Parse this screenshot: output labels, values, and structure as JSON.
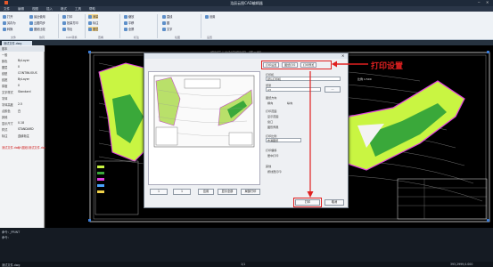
{
  "window": {
    "title": "浩辰云图CAD编辑器"
  },
  "menu": [
    "文件",
    "编辑",
    "视图",
    "插入",
    "格式",
    "工具",
    "帮助"
  ],
  "ribbon": {
    "col1": [
      "打开",
      "另存为",
      "转换"
    ],
    "col2": [
      "最近使用",
      "云图同步",
      "图纸比较"
    ],
    "col3": [
      "打印",
      "批量打印",
      "导出"
    ],
    "col4": [
      "测量",
      "标注",
      "图层"
    ],
    "col5": [
      "缩放",
      "平移",
      "全屏"
    ],
    "col6": [
      "直线",
      "圆",
      "文字"
    ],
    "col7": [
      "设置"
    ],
    "groups": [
      "文件",
      "协同",
      "CAD转换",
      "查看",
      "标注",
      "绘图",
      "设置"
    ]
  },
  "doc_tab": "测试文件.dwg",
  "props": {
    "header": "基本",
    "rows": [
      {
        "k": "一般",
        "v": ""
      },
      {
        "k": "颜色",
        "v": "ByLayer"
      },
      {
        "k": "图层",
        "v": "0"
      },
      {
        "k": "线型",
        "v": "CONTINUOUS"
      },
      {
        "k": "线宽",
        "v": "ByLayer"
      },
      {
        "k": "厚度",
        "v": "0"
      },
      {
        "k": "文字样式",
        "v": "Standard"
      },
      {
        "k": "字体",
        "v": ""
      },
      {
        "k": "字体高度",
        "v": "2.5"
      },
      {
        "k": "点颜色",
        "v": "白"
      },
      {
        "k": "其他",
        "v": ""
      },
      {
        "k": "显示尺寸",
        "v": "0.18"
      },
      {
        "k": "样式",
        "v": "STANDARD"
      },
      {
        "k": "标注",
        "v": "连续标注"
      }
    ],
    "footer_k": "测试文件.dwg",
    "footer_v": "D:\\图纸\\测试文件.dwg"
  },
  "dialog": {
    "tabs": [
      "打印设置",
      "图纸打印",
      "打印预览"
    ],
    "printer_label": "打印机",
    "printer_value": "默认打印机",
    "paper_label": "纸张",
    "paper_value": "A3",
    "orient_label": "图纸方向",
    "orient_opts": [
      "横向",
      "纵向"
    ],
    "range_label": "打印范围",
    "range_opts": [
      "显示范围",
      "窗口",
      "图形界限"
    ],
    "scale_label": "打印比例",
    "scale_value": "布满图纸",
    "offset_label": "打印偏移",
    "center_label": "居中打印",
    "other_label": "其他",
    "other_opt": "按线宽打印",
    "page_prev": "1",
    "page_next": "1",
    "btn_apply": "应用",
    "btn_full": "显示全部",
    "btn_window": "局部打印",
    "btn_print": "打印",
    "btn_cancel": "取消"
  },
  "annotation": "打印设置",
  "drawing": {
    "title": "规划区土地利用规划图（第三期）",
    "ratio": "比例 1:500"
  },
  "status": {
    "cmd1": "命令: _PRINT",
    "cmd2": "命令:",
    "file": "测试文件.dwg",
    "page": "1/1",
    "coords": "393,2999,0.000"
  },
  "colors": {
    "accent": "#e02020",
    "highlight": "#c9f542"
  }
}
